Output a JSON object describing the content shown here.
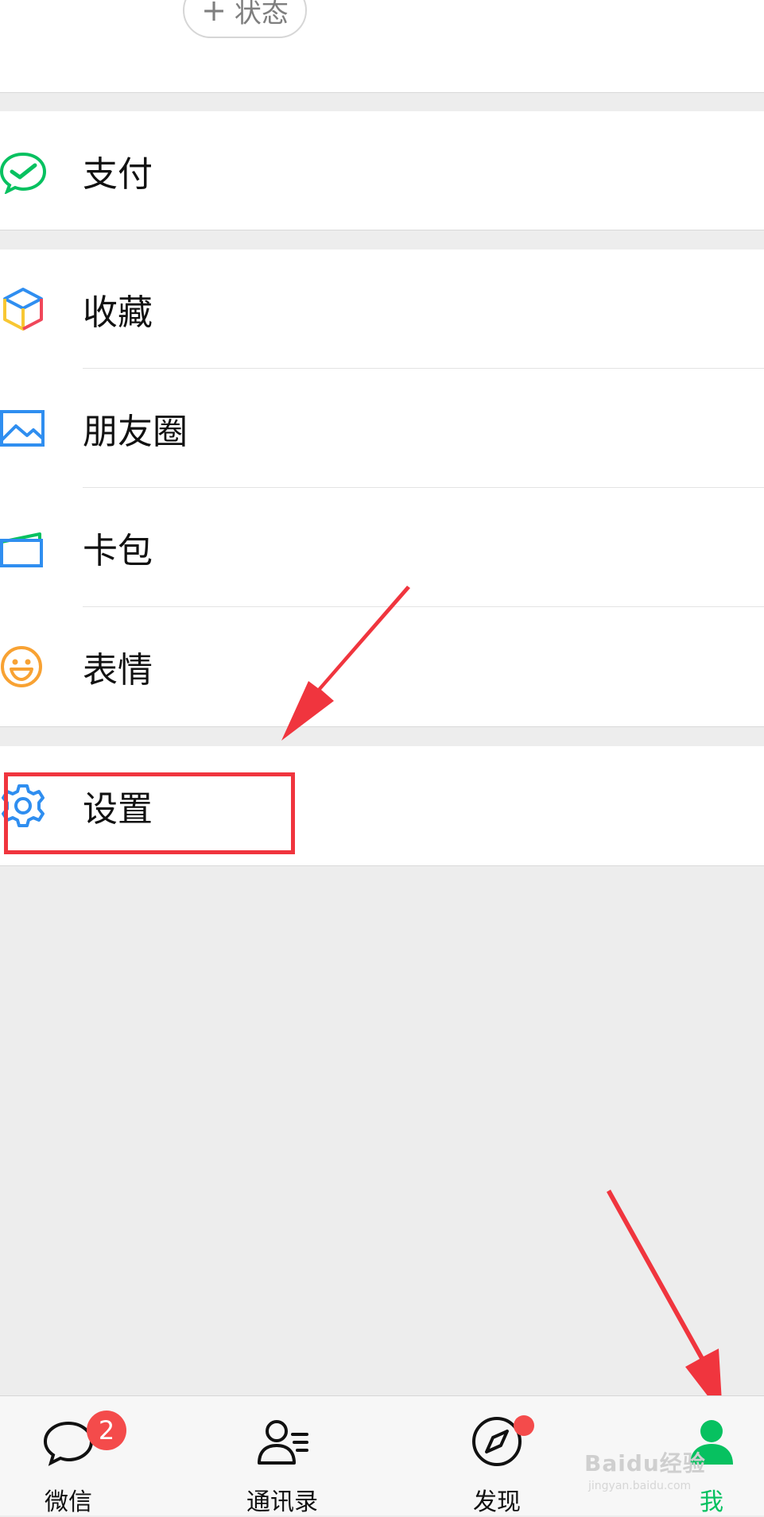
{
  "header": {
    "status_button": "状态",
    "plus_symbol": "+"
  },
  "menu": {
    "pay": {
      "label": "支付",
      "icon": "wechat-pay-icon"
    },
    "favorites": {
      "label": "收藏",
      "icon": "cube-icon"
    },
    "moments": {
      "label": "朋友圈",
      "icon": "image-icon"
    },
    "cards": {
      "label": "卡包",
      "icon": "card-wallet-icon"
    },
    "stickers": {
      "label": "表情",
      "icon": "smiley-icon"
    },
    "settings": {
      "label": "设置",
      "icon": "gear-icon"
    }
  },
  "tabbar": {
    "tabs": [
      {
        "label": "微信",
        "icon": "chat-bubble-icon",
        "badge": "2"
      },
      {
        "label": "通讯录",
        "icon": "contacts-icon"
      },
      {
        "label": "发现",
        "icon": "compass-icon",
        "dot": true
      },
      {
        "label": "我",
        "icon": "person-icon",
        "active": true
      }
    ]
  },
  "watermark": {
    "main": "Baidu经验",
    "sub": "jingyan.baidu.com"
  },
  "colors": {
    "active_green": "#07c160",
    "badge_red": "#f44b4b",
    "annotation_red": "#f0353e",
    "background_gray": "#ededed"
  }
}
